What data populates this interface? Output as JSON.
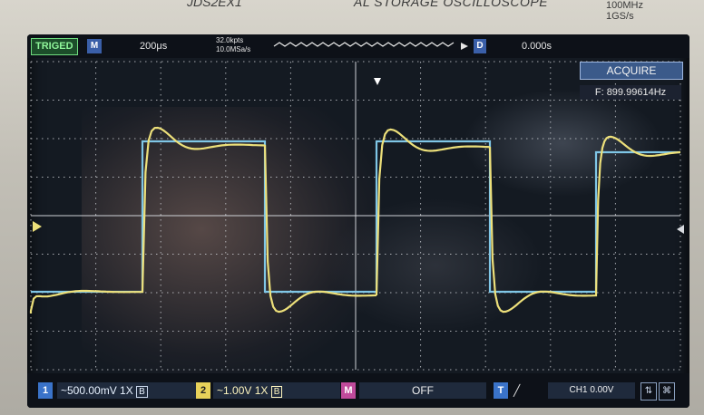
{
  "header": {
    "model_fragment": "JDS2EX1",
    "title_fragment": "AL STORAGE OSCILLOSCOPE",
    "spec_bandwidth": "100MHz",
    "spec_sample": "1GS/s"
  },
  "status": {
    "trigger_state": "TRIGED",
    "menu_key": "M",
    "timebase": "200μs",
    "record_length": "32.0kpts",
    "sample_rate": "10.0MSa/s",
    "delay_key": "D",
    "delay_value": "0.000s",
    "mode": "ACQUIRE",
    "frequency": "F: 899.99614Hz"
  },
  "channels": {
    "ch1_number": "1",
    "ch1_scale": "~500.00mV  1X",
    "ch1_bw": "B",
    "ch2_number": "2",
    "ch2_scale": "~1.00V  1X",
    "ch2_bw": "B",
    "math_key": "M",
    "math_state": "OFF",
    "trigger_key": "T",
    "trigger_edge": "╱",
    "trigger_level": "CH1 0.00V"
  },
  "colors": {
    "ch1": "#7fc6e6",
    "ch2": "#ede07a",
    "grid": "#d8dbe0",
    "trigger_badge": "#8ff59a"
  },
  "icons": [
    "usb-icon",
    "network-icon"
  ]
}
